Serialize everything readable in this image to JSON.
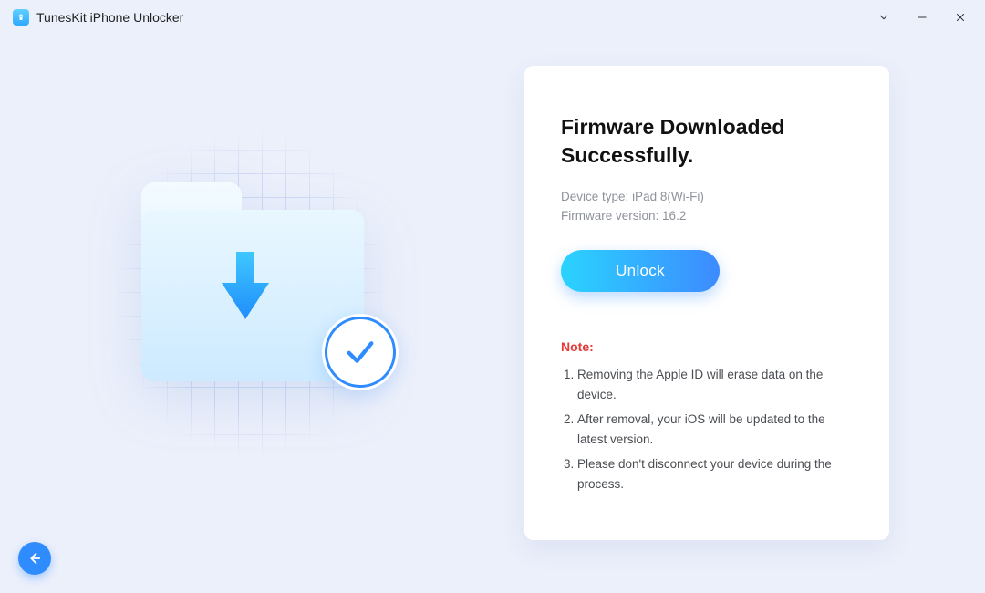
{
  "app": {
    "title": "TunesKit iPhone Unlocker"
  },
  "status": {
    "heading_line1": "Firmware Downloaded",
    "heading_line2": "Successfully."
  },
  "device": {
    "type_label": "Device type:",
    "type_value": "iPad 8(Wi-Fi)",
    "fw_label": "Firmware version:",
    "fw_value": "16.2"
  },
  "actions": {
    "unlock": "Unlock"
  },
  "note": {
    "title": "Note:",
    "items": [
      "Removing the Apple ID will erase data on the device.",
      "After removal, your iOS will be updated to the latest version.",
      "Please don't disconnect your device during the process."
    ]
  }
}
